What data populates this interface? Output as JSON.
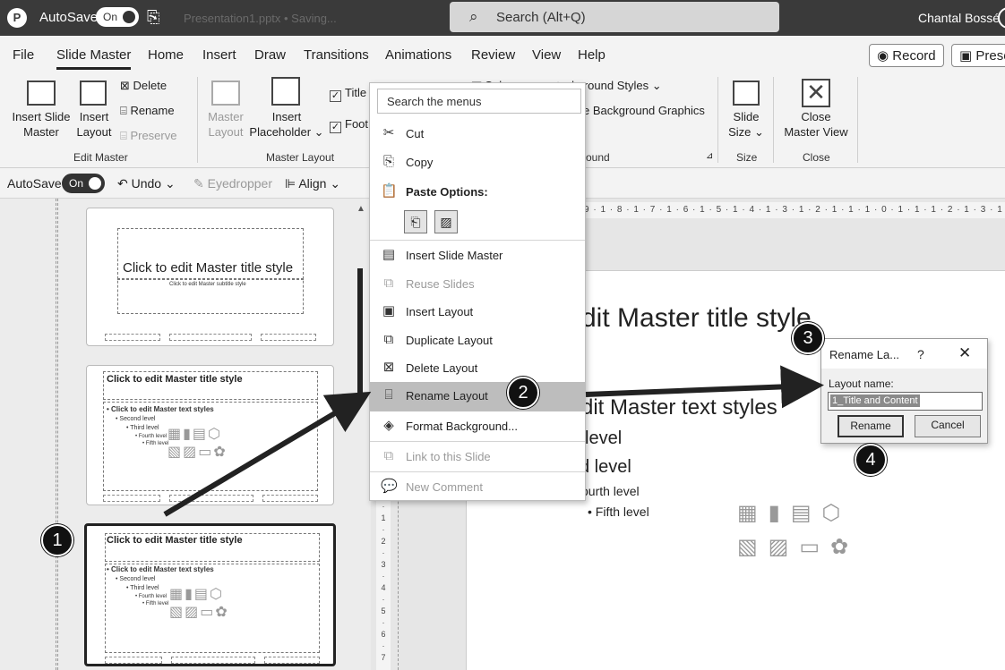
{
  "titlebar": {
    "autosave_label": "AutoSave",
    "autosave_state": "On",
    "filename": "Presentation1.pptx • Saving...",
    "search_placeholder": "Search (Alt+Q)",
    "user_name": "Chantal Bossé"
  },
  "tabs": [
    "File",
    "Slide Master",
    "Home",
    "Insert",
    "Draw",
    "Transitions",
    "Animations",
    "Review",
    "View",
    "Help"
  ],
  "active_tab": "Slide Master",
  "record_label": "Record",
  "present_label": "Prese",
  "ribbon": {
    "edit_master": {
      "insert_slide_master": [
        "Insert Slide",
        "Master"
      ],
      "insert_layout": [
        "Insert",
        "Layout"
      ],
      "delete": "Delete",
      "rename": "Rename",
      "preserve": "Preserve",
      "label": "Edit Master"
    },
    "master_layout": {
      "master_layout_btn": [
        "Master",
        "Layout"
      ],
      "insert_placeholder": [
        "Insert",
        "Placeholder ⌄"
      ],
      "title_chk": "Title",
      "footers_chk": "Foot",
      "label": "Master Layout"
    },
    "background": {
      "colors_partial": "Col",
      "background_styles": "ckground Styles ⌄",
      "hide_bg": "e Background Graphics",
      "label": "ound"
    },
    "size": {
      "slide_size": [
        "Slide",
        "Size ⌄"
      ],
      "label": "Size"
    },
    "close": {
      "close_master": [
        "Close",
        "Master View"
      ],
      "label": "Close"
    }
  },
  "qat": {
    "autosave": "AutoSave",
    "autosave_state": "On",
    "undo": "Undo",
    "eyedropper": "Eyedropper",
    "align": "Align ⌄"
  },
  "thumbnails": {
    "master_title": "Click to edit Master title style",
    "master_subtitle": "Click to edit Master subtitle style",
    "layout_title": "Click to edit Master title style",
    "text_levels": [
      "• Click to edit Master text styles",
      "• Second level",
      "• Third level",
      "• Fourth level",
      "• Fifth level"
    ]
  },
  "ruler_text": "9 · 1 · 8 · 1 · 7 · 1 · 6 · 1 · 5 · 1 · 4 · 1 · 3 · 1 · 2 · 1 · 1 · 1 · 0 · 1 · 1 · 1 · 2 · 1 · 3 · 1 · 4 · 1 · 5 · 1 · 6 · 1 · 7 · 1 · 8 ·",
  "vruler_text": [
    "·",
    "1",
    "·",
    "2",
    "·",
    "3",
    "·",
    "4",
    "·",
    "5",
    "·",
    "6",
    "·",
    "7"
  ],
  "slide": {
    "title": "dit Master title style",
    "body_l1": "dit Master text styles",
    "body_l2": "level",
    "body_l3": "d level",
    "body_l4": "ourth level",
    "body_l5": "•   Fifth level"
  },
  "context_menu": {
    "search": "Search the menus",
    "items": {
      "cut": "Cut",
      "copy": "Copy",
      "paste_options": "Paste Options:",
      "insert_slide_master": "Insert Slide Master",
      "reuse_slides": "Reuse Slides",
      "insert_layout": "Insert Layout",
      "duplicate_layout": "Duplicate Layout",
      "delete_layout": "Delete Layout",
      "rename_layout": "Rename Layout",
      "format_background": "Format Background...",
      "link_to_slide": "Link to this Slide",
      "new_comment": "New Comment"
    }
  },
  "dialog": {
    "title": "Rename La...",
    "help": "?",
    "close": "✕",
    "field_label": "Layout name:",
    "field_value": "1_Title and Content",
    "rename_btn": "Rename",
    "cancel_btn": "Cancel"
  },
  "callouts": [
    "1",
    "2",
    "3",
    "4"
  ]
}
